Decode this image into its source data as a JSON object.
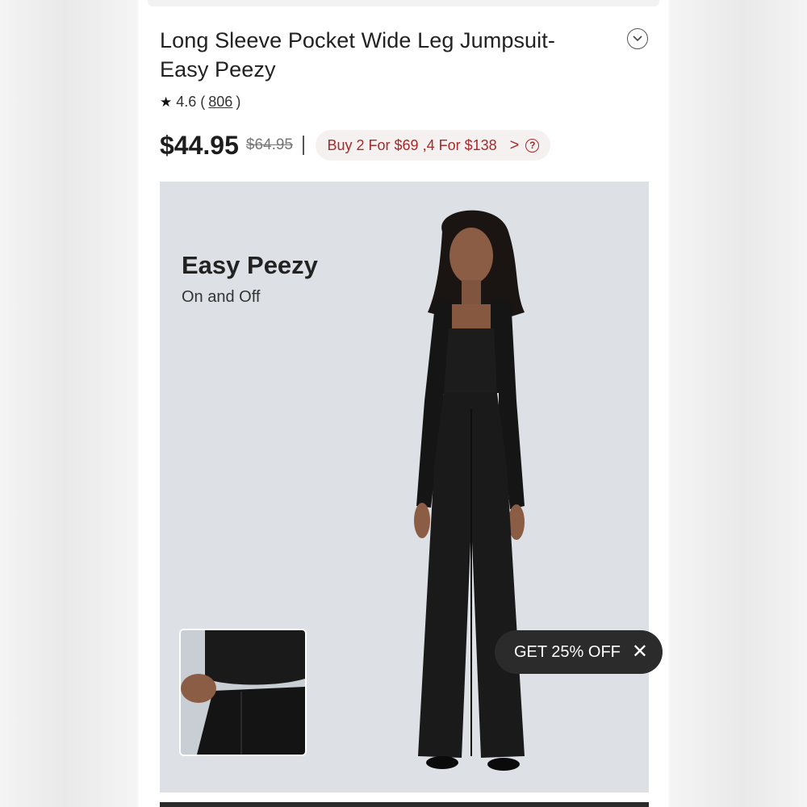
{
  "product": {
    "title": "Long Sleeve Pocket Wide Leg Jumpsuit-Easy Peezy",
    "rating": "4.6",
    "rating_open": "(",
    "review_count": "806",
    "rating_close": ")",
    "price": "$44.95",
    "original_price": "$64.95",
    "promo_text": "Buy 2 For $69 ,4 For $138",
    "promo_chevron": ">",
    "promo_help": "?"
  },
  "hero": {
    "headline": "Easy Peezy",
    "subheadline": "On and Off"
  },
  "popup": {
    "label": "GET 25% OFF",
    "close": "✕"
  },
  "colors": {
    "promo_red": "#a52a2a",
    "hero_bg": "#dde1e6",
    "pill_bg": "#2b2b2b"
  },
  "icons": {
    "expand": "chevron-down-icon",
    "rating": "star-icon",
    "promo": "chevron-right-icon",
    "help": "question-icon",
    "close": "close-icon"
  }
}
